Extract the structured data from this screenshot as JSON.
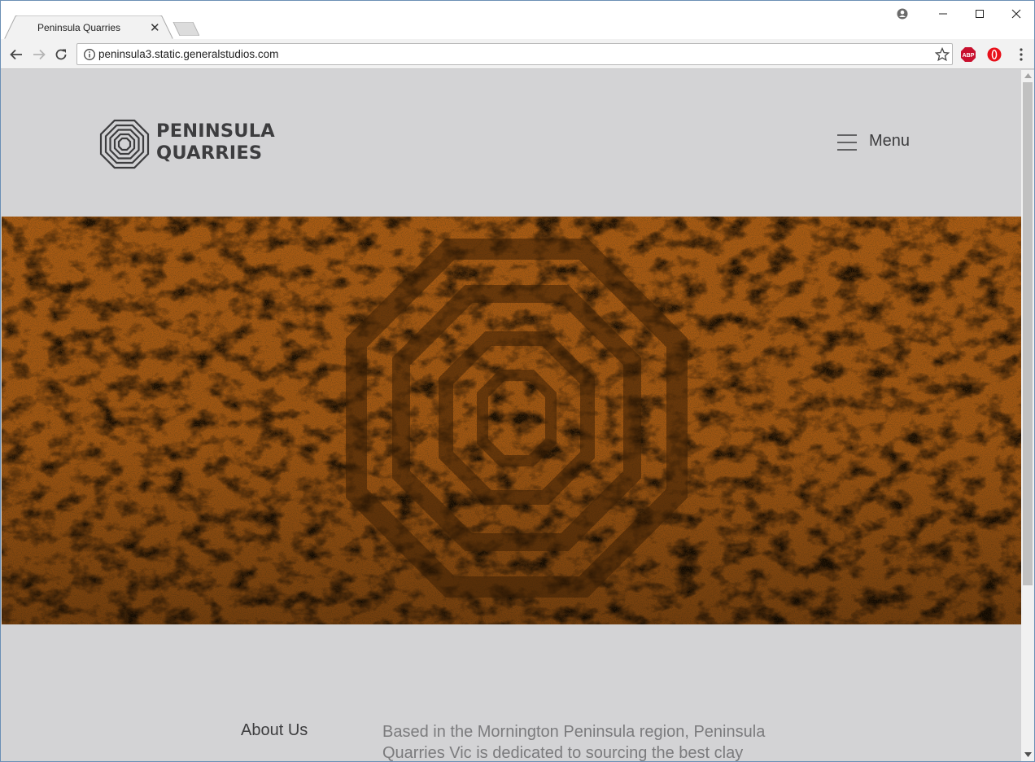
{
  "browser": {
    "tab_title": "Peninsula Quarries",
    "url": "peninsula3.static.generalstudios.com",
    "extensions": {
      "abp_label": "ABP"
    }
  },
  "site": {
    "logo_line1": "PENINSULA",
    "logo_line2": "QUARRIES",
    "menu_label": "Menu",
    "about_heading": "About Us",
    "about_text_line1": "Based in the Mornington Peninsula region, Peninsula",
    "about_text_line2": "Quarries Vic is dedicated to sourcing the best clay"
  },
  "colors": {
    "page_background": "#d3d3d5",
    "hero_tint": "#a85a12",
    "text_dark": "#3d3d3f",
    "text_muted": "#7b7b7d"
  },
  "icons": {
    "profile": "profile-icon",
    "back": "back-arrow-icon",
    "forward": "forward-arrow-icon",
    "reload": "reload-icon",
    "info": "info-icon",
    "bookmark": "star-icon",
    "adblock": "adblock-plus-icon",
    "opera": "opera-icon",
    "more": "kebab-menu-icon",
    "menu": "hamburger-icon"
  }
}
